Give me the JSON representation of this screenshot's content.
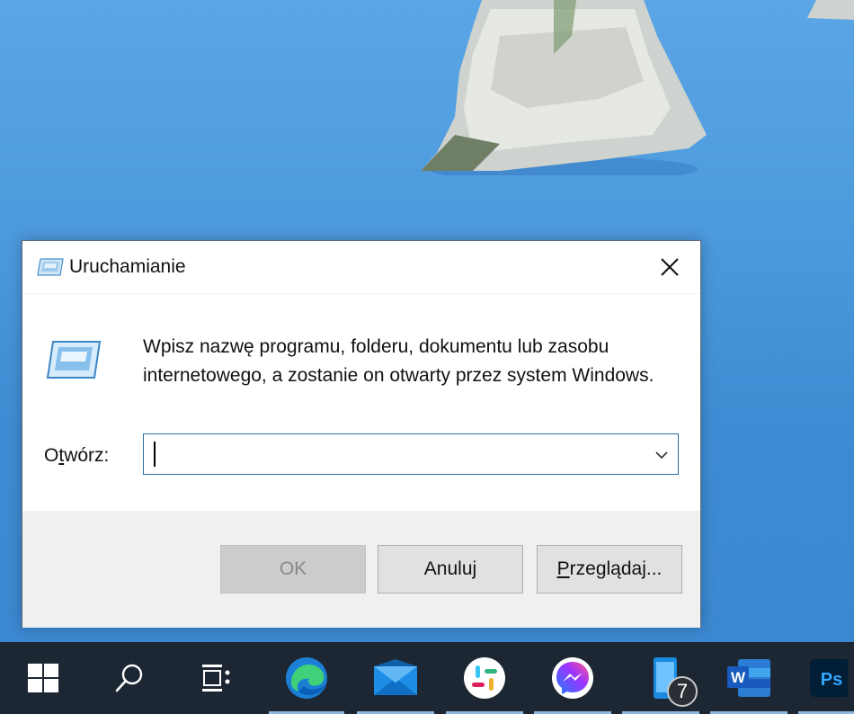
{
  "dialog": {
    "title": "Uruchamianie",
    "description": "Wpisz nazwę programu, folderu, dokumentu lub zasobu internetowego, a zostanie on otwarty przez system Windows.",
    "open_label_prefix": "O",
    "open_label_underlined": "t",
    "open_label_suffix": "wórz:",
    "open_value": "",
    "ok_label": "OK",
    "cancel_label": "Anuluj",
    "browse_label_prefix": "",
    "browse_label_underlined": "P",
    "browse_label_suffix": "rzeglądaj..."
  },
  "taskbar": {
    "items": [
      {
        "name": "start-icon"
      },
      {
        "name": "search-icon"
      },
      {
        "name": "task-view-icon"
      },
      {
        "name": "edge-icon"
      },
      {
        "name": "mail-icon"
      },
      {
        "name": "slack-icon"
      },
      {
        "name": "messenger-icon"
      },
      {
        "name": "phone-app-icon"
      },
      {
        "name": "word-icon"
      },
      {
        "name": "photoshop-icon"
      }
    ],
    "badge_count": "7",
    "photoshop_label": "Ps",
    "word_label": "W"
  },
  "colors": {
    "taskbar": "#1d2733",
    "accent_border": "#2b6f9e",
    "footer": "#f0f0f0"
  }
}
